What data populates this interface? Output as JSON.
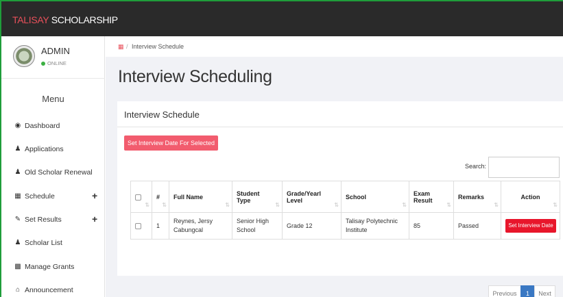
{
  "app": {
    "brand_accent": "TALISAY",
    "brand_rest": " SCHOLARSHIP",
    "accent_color": "#e8505b"
  },
  "profile": {
    "name": "ADMIN",
    "status": "ONLINE"
  },
  "sidebar": {
    "menu_title": "Menu",
    "items": [
      {
        "label": "Dashboard",
        "icon": "dashboard-icon"
      },
      {
        "label": "Applications",
        "icon": "users-icon"
      },
      {
        "label": "Old Scholar Renewal",
        "icon": "users-icon"
      },
      {
        "label": "Schedule",
        "icon": "calendar-icon",
        "expand": "+"
      },
      {
        "label": "Set Results",
        "icon": "pencil-icon",
        "expand": "+"
      },
      {
        "label": "Scholar List",
        "icon": "users-icon"
      },
      {
        "label": "Manage Grants",
        "icon": "money-icon"
      },
      {
        "label": "Announcement",
        "icon": "home-icon"
      }
    ]
  },
  "breadcrumb": {
    "separator": "/",
    "current": "Interview Schedule"
  },
  "page": {
    "title": "Interview Scheduling"
  },
  "panel": {
    "title": "Interview Schedule",
    "bulk_button": "Set Interview Date For Selected",
    "search_label": "Search:",
    "search_value": ""
  },
  "table": {
    "columns": [
      "#",
      "Full Name",
      "Student Type",
      "Grade/Yearl Level",
      "School",
      "Exam Result",
      "Remarks",
      "Action"
    ],
    "rows": [
      {
        "num": "1",
        "full_name": "Reynes, Jersy Cabungcal",
        "student_type": "Senior High School",
        "grade_level": "Grade 12",
        "school": "Talisay Polytechnic Institute",
        "exam_result": "85",
        "remarks": "Passed",
        "action": "Set Interview Date"
      }
    ]
  },
  "pagination": {
    "previous": "Previous",
    "current_page": "1",
    "next": "Next"
  }
}
